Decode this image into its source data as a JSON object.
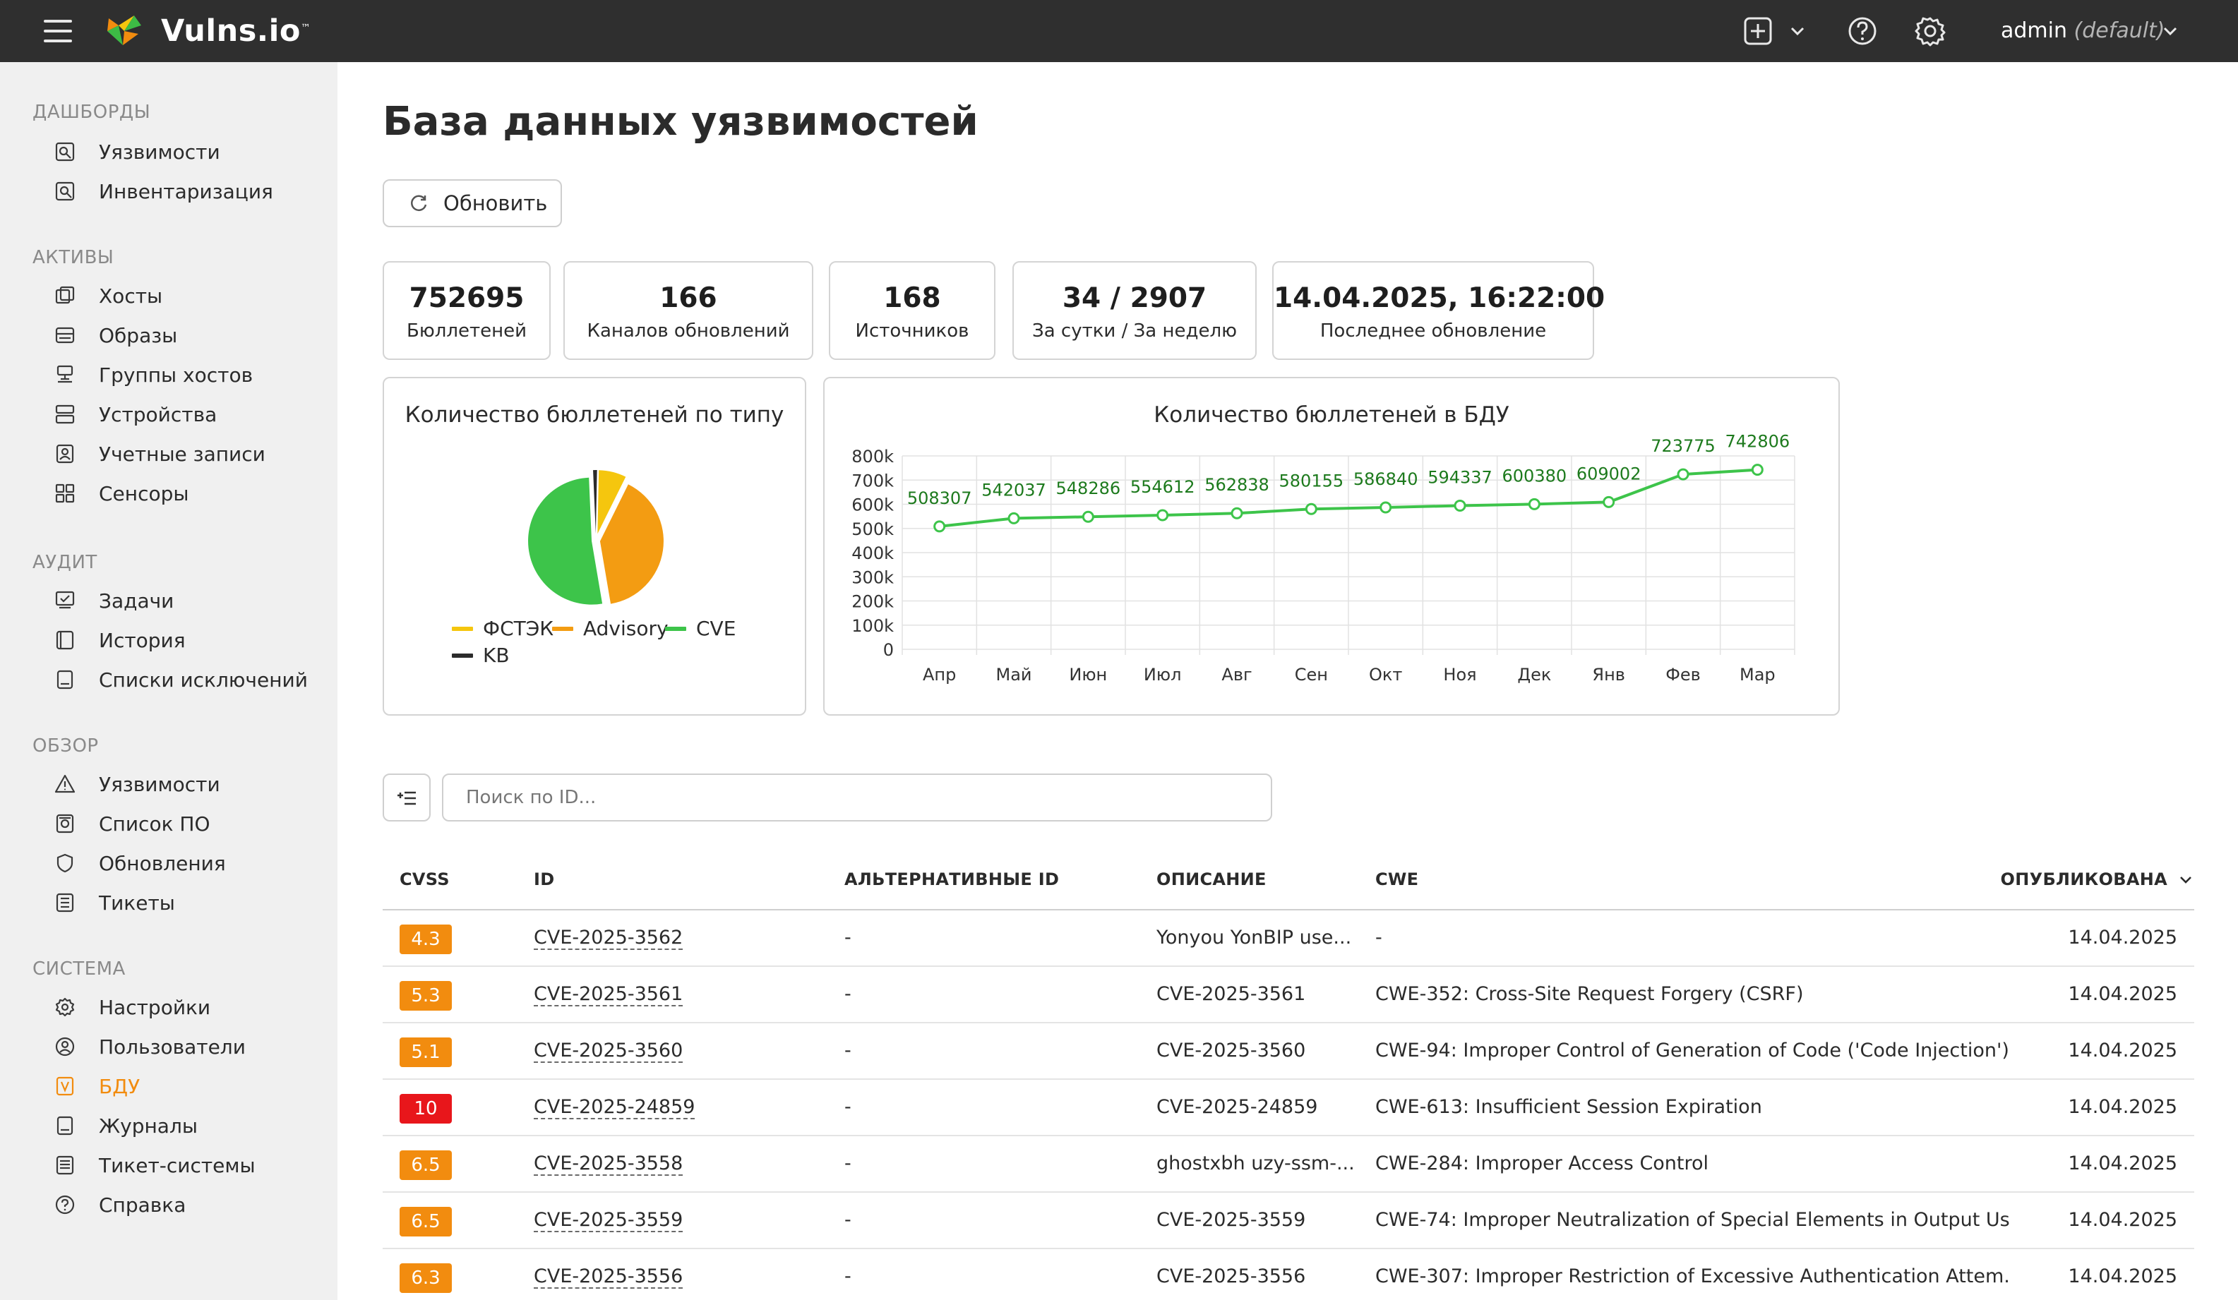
{
  "header": {
    "brand": "Vulns.io",
    "brand_mark": "™",
    "user": "admin",
    "user_role": "(default)"
  },
  "sidebar": {
    "groups": [
      {
        "label": "ДАШБОРДЫ",
        "items": [
          {
            "label": "Уязвимости",
            "icon": "dashboard-vulns-icon"
          },
          {
            "label": "Инвентаризация",
            "icon": "inventory-icon"
          }
        ]
      },
      {
        "label": "АКТИВЫ",
        "items": [
          {
            "label": "Хосты",
            "icon": "hosts-icon"
          },
          {
            "label": "Образы",
            "icon": "images-icon"
          },
          {
            "label": "Группы хостов",
            "icon": "host-groups-icon"
          },
          {
            "label": "Устройства",
            "icon": "devices-icon"
          },
          {
            "label": "Учетные записи",
            "icon": "accounts-icon"
          },
          {
            "label": "Сенсоры",
            "icon": "sensors-icon"
          }
        ]
      },
      {
        "label": "АУДИТ",
        "items": [
          {
            "label": "Задачи",
            "icon": "tasks-icon"
          },
          {
            "label": "История",
            "icon": "history-icon"
          },
          {
            "label": "Списки исключений",
            "icon": "exclusions-icon"
          }
        ]
      },
      {
        "label": "ОБЗОР",
        "items": [
          {
            "label": "Уязвимости",
            "icon": "warning-icon"
          },
          {
            "label": "Список ПО",
            "icon": "software-icon"
          },
          {
            "label": "Обновления",
            "icon": "shield-icon"
          },
          {
            "label": "Тикеты",
            "icon": "tickets-icon"
          }
        ]
      },
      {
        "label": "СИСТЕМА",
        "items": [
          {
            "label": "Настройки",
            "icon": "gear-icon"
          },
          {
            "label": "Пользователи",
            "icon": "user-icon"
          },
          {
            "label": "БДУ",
            "icon": "bdu-icon",
            "active": true
          },
          {
            "label": "Журналы",
            "icon": "logs-icon"
          },
          {
            "label": "Тикет-системы",
            "icon": "ticket-systems-icon"
          },
          {
            "label": "Справка",
            "icon": "help-icon"
          }
        ]
      }
    ]
  },
  "main": {
    "title": "База данных уязвимостей",
    "refresh_label": "Обновить",
    "stats": [
      {
        "value": "752695",
        "label": "Бюллетеней"
      },
      {
        "value": "166",
        "label": "Каналов обновлений"
      },
      {
        "value": "168",
        "label": "Источников"
      },
      {
        "value": "34 / 2907",
        "label": "За сутки / За неделю"
      },
      {
        "value": "14.04.2025, 16:22:00",
        "label": "Последнее обновление"
      }
    ],
    "search_placeholder": "Поиск по ID...",
    "table": {
      "columns": [
        "CVSS",
        "ID",
        "АЛЬТЕРНАТИВНЫЕ ID",
        "ОПИСАНИЕ",
        "CWE",
        "ОПУБЛИКОВАНА"
      ],
      "rows": [
        {
          "cvss": "4.3",
          "color": "#f28c0f",
          "id": "CVE-2025-3562",
          "alt": "-",
          "desc": "Yonyou YonBIP use...",
          "cwe": "-",
          "date": "14.04.2025"
        },
        {
          "cvss": "5.3",
          "color": "#f28c0f",
          "id": "CVE-2025-3561",
          "alt": "-",
          "desc": "CVE-2025-3561",
          "cwe": "CWE-352: Cross-Site Request Forgery (CSRF)",
          "date": "14.04.2025"
        },
        {
          "cvss": "5.1",
          "color": "#f28c0f",
          "id": "CVE-2025-3560",
          "alt": "-",
          "desc": "CVE-2025-3560",
          "cwe": "CWE-94: Improper Control of Generation of Code ('Code Injection')",
          "date": "14.04.2025"
        },
        {
          "cvss": "10",
          "color": "#e8161b",
          "id": "CVE-2025-24859",
          "alt": "-",
          "desc": "CVE-2025-24859",
          "cwe": "CWE-613: Insufficient Session Expiration",
          "date": "14.04.2025"
        },
        {
          "cvss": "6.5",
          "color": "#f28c0f",
          "id": "CVE-2025-3558",
          "alt": "-",
          "desc": "ghostxbh uzy-ssm-...",
          "cwe": "CWE-284: Improper Access Control",
          "date": "14.04.2025"
        },
        {
          "cvss": "6.5",
          "color": "#f28c0f",
          "id": "CVE-2025-3559",
          "alt": "-",
          "desc": "CVE-2025-3559",
          "cwe": "CWE-74: Improper Neutralization of Special Elements in Output Us...",
          "date": "14.04.2025"
        },
        {
          "cvss": "6.3",
          "color": "#f28c0f",
          "id": "CVE-2025-3556",
          "alt": "-",
          "desc": "CVE-2025-3556",
          "cwe": "CWE-307: Improper Restriction of Excessive Authentication Attem...",
          "date": "14.04.2025"
        }
      ]
    }
  },
  "chart_data": [
    {
      "type": "pie",
      "title": "Количество бюллетеней по типу",
      "legend": "bottom",
      "series": [
        {
          "name": "ФСТЭК",
          "value": 7,
          "color": "#f5c60e"
        },
        {
          "name": "Advisory",
          "value": 40,
          "color": "#f39c12"
        },
        {
          "name": "CVE",
          "value": 52,
          "color": "#3dc44a"
        },
        {
          "name": "KB",
          "value": 1,
          "color": "#2b2b2b"
        }
      ]
    },
    {
      "type": "line",
      "title": "Количество бюллетеней в БДУ",
      "categories": [
        "Апр",
        "Май",
        "Июн",
        "Июл",
        "Авг",
        "Сен",
        "Окт",
        "Ноя",
        "Дек",
        "Янв",
        "Фев",
        "Мар"
      ],
      "values": [
        508307,
        542037,
        548286,
        554612,
        562838,
        580155,
        586840,
        594337,
        600380,
        609002,
        723775,
        742806
      ],
      "ylim": [
        0,
        800000
      ],
      "yticks": [
        "0",
        "100k",
        "200k",
        "300k",
        "400k",
        "500k",
        "600k",
        "700k",
        "800k"
      ],
      "grid": true,
      "color": "#3dc44a",
      "label_color": "#1d7a1d"
    }
  ]
}
